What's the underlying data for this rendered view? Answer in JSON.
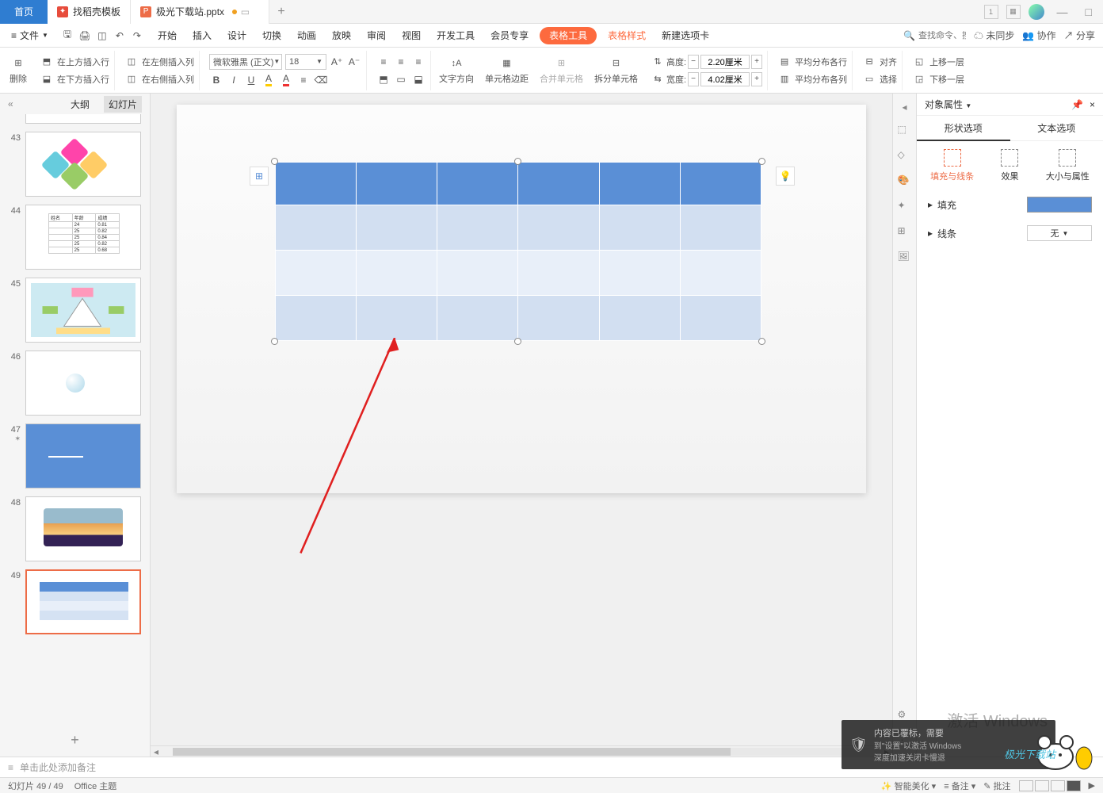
{
  "titlebar": {
    "home": "首页",
    "tab_template": "找稻壳模板",
    "tab_doc": "极光下载站.pptx",
    "add": "+"
  },
  "window_controls": {
    "min": "—",
    "max": "□",
    "close": "×"
  },
  "menubar": {
    "file": "文件",
    "items": [
      "开始",
      "插入",
      "设计",
      "切换",
      "动画",
      "放映",
      "审阅",
      "视图",
      "开发工具",
      "会员专享"
    ],
    "table_tool": "表格工具",
    "table_style": "表格样式",
    "new_tab": "新建选项卡",
    "search_cmd_ph": "查找命令、搜索模板",
    "unsync": "未同步",
    "coop": "协作",
    "share": "分享"
  },
  "ribbon": {
    "delete": "删除",
    "ins_above": "在上方插入行",
    "ins_below": "在下方插入行",
    "ins_left": "在左侧插入列",
    "ins_right": "在右侧插入列",
    "font_name": "微软雅黑 (正文)",
    "font_size": "18",
    "text_dir": "文字方向",
    "cell_margin": "单元格边距",
    "merge": "合并单元格",
    "split": "拆分单元格",
    "height_lbl": "高度:",
    "height_val": "2.20厘米",
    "width_lbl": "宽度:",
    "width_val": "4.02厘米",
    "dist_rows": "平均分布各行",
    "dist_cols": "平均分布各列",
    "align": "对齐",
    "select": "选择",
    "bring_fwd": "上移一层",
    "send_back": "下移一层"
  },
  "slidepanel": {
    "tab_outline": "大纲",
    "tab_slides": "幻灯片",
    "nums": [
      "43",
      "44",
      "45",
      "46",
      "47",
      "48",
      "49"
    ],
    "add": "+"
  },
  "notes": {
    "placeholder": "单击此处添加备注"
  },
  "rpanel": {
    "title": "对象属性",
    "tab_shape": "形状选项",
    "tab_text": "文本选项",
    "sub_fill": "填充与线条",
    "sub_effect": "效果",
    "sub_size": "大小与属性",
    "fill_lbl": "填充",
    "line_lbl": "线条",
    "line_val": "无"
  },
  "statusbar": {
    "slide_info": "幻灯片 49 / 49",
    "theme": "Office 主题",
    "beautify": "智能美化",
    "notes_btn": "备注",
    "comment_btn": "批注"
  },
  "overlay": {
    "activate_title": "激活 Windows",
    "line1": "内容已覆标，需要",
    "line2": "到\"设置\"以激活 Windows",
    "line3": "深度加速关闭卡慢退",
    "watermark": "极光下载站"
  }
}
